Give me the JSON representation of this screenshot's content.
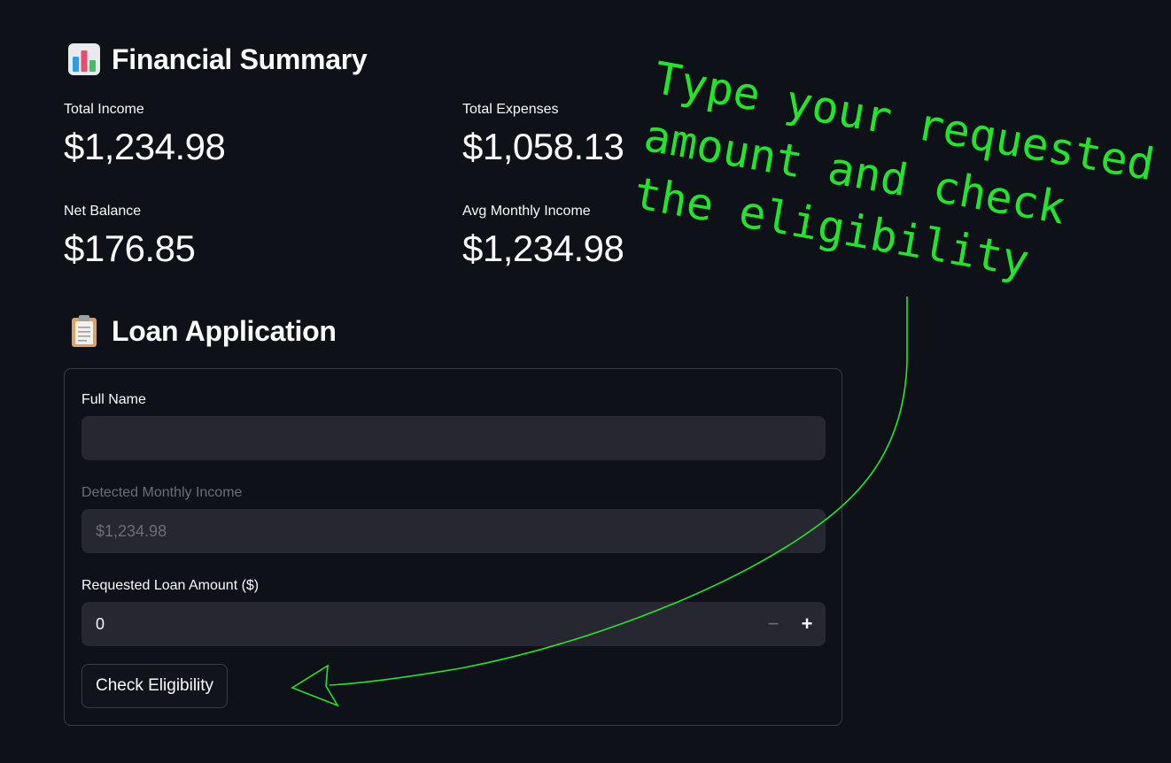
{
  "summary": {
    "title": "Financial Summary",
    "icon": "bar-chart-icon",
    "metrics": [
      {
        "label": "Total Income",
        "value": "$1,234.98"
      },
      {
        "label": "Total Expenses",
        "value": "$1,058.13"
      },
      {
        "label": "Net Balance",
        "value": "$176.85"
      },
      {
        "label": "Avg Monthly Income",
        "value": "$1,234.98"
      }
    ]
  },
  "loan": {
    "title": "Loan Application",
    "icon": "clipboard-icon",
    "full_name": {
      "label": "Full Name",
      "value": "",
      "placeholder": ""
    },
    "income": {
      "label": "Detected Monthly Income",
      "value": "$1,234.98"
    },
    "amount": {
      "label": "Requested Loan Amount ($)",
      "value": "0",
      "minus": "−",
      "plus": "+"
    },
    "button_label": "Check Eligibility"
  },
  "annotation": {
    "lines": [
      "Type your requested",
      "amount and check",
      "the eligibility"
    ],
    "color": "#22e52a"
  },
  "colors": {
    "background": "#0e1117",
    "input_bg": "#262730",
    "border": "#3a3d46"
  }
}
